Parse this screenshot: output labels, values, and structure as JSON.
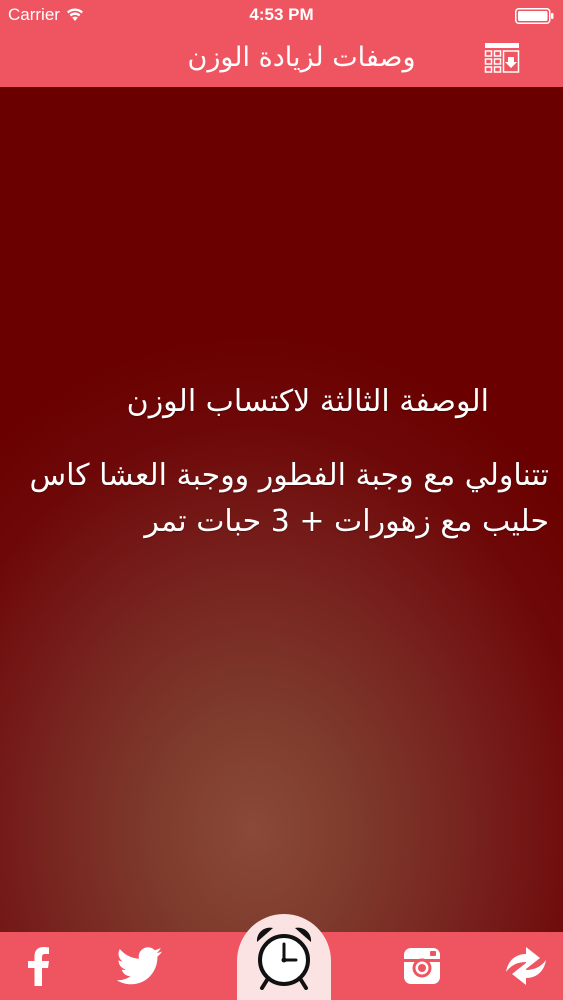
{
  "status_bar": {
    "carrier": "Carrier",
    "time": "4:53 PM",
    "icons": [
      "wifi-icon",
      "battery-icon"
    ]
  },
  "nav": {
    "title": "وصفات لزيادة الوزن",
    "icon": "download-list-icon"
  },
  "content": {
    "title": "الوصفة الثالثة لاكتساب الوزن",
    "body": "تتناولي مع وجبة الفطور ووجبة العشا كاس حليب مع زهورات + 3 حبات تمر"
  },
  "tab_bar": {
    "items": [
      {
        "icon": "facebook-icon"
      },
      {
        "icon": "twitter-icon"
      },
      {
        "icon": "alarm-clock-icon"
      },
      {
        "icon": "instagram-icon"
      },
      {
        "icon": "share-icon"
      }
    ]
  },
  "colors": {
    "bar_red": "#ef5561",
    "content_dark_red": "#6a0000",
    "alarm_tab_bg": "#fbe3e4",
    "text": "#ffffff"
  }
}
